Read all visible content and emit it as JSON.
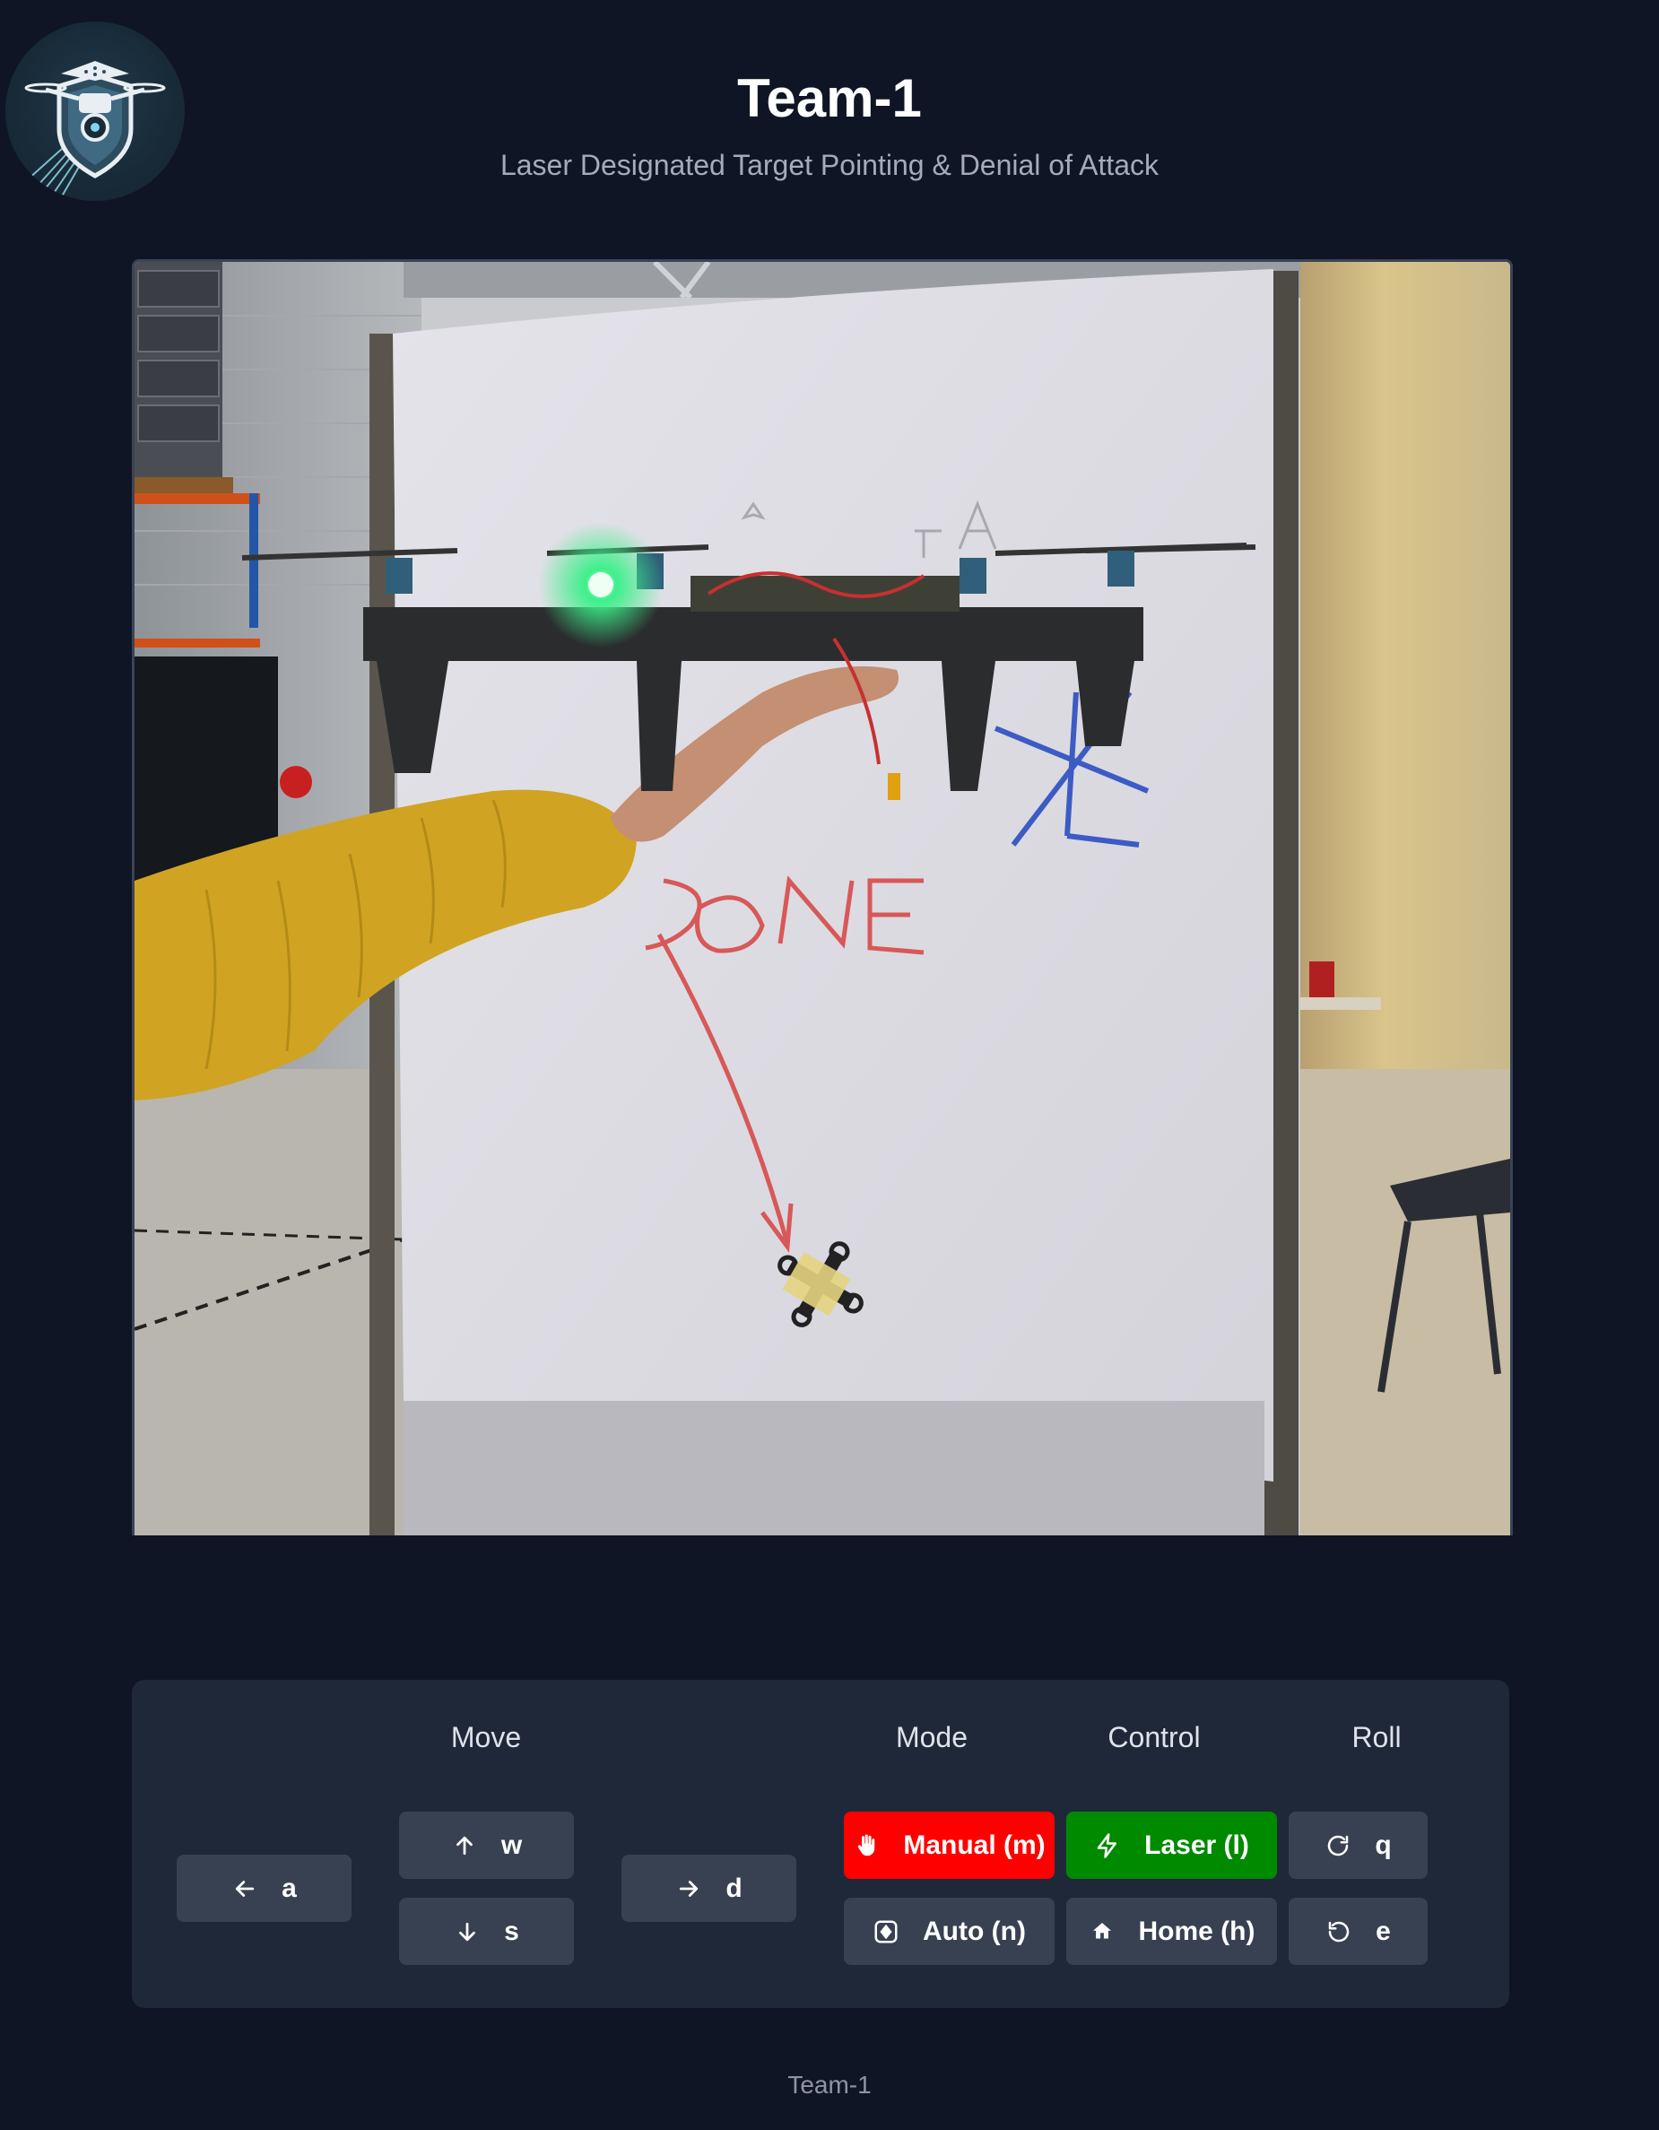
{
  "header": {
    "title": "Team-1",
    "subtitle": "Laser Designated Target Pointing & Denial of Attack",
    "logo_icon": "drone-shield-logo-icon"
  },
  "video": {
    "description_icon": "camera-feed"
  },
  "controls": {
    "groups": {
      "move": "Move",
      "mode": "Mode",
      "control": "Control",
      "roll": "Roll"
    },
    "buttons": {
      "left": {
        "key": "a",
        "icon": "arrow-left-icon"
      },
      "up": {
        "key": "w",
        "icon": "arrow-up-icon"
      },
      "down": {
        "key": "s",
        "icon": "arrow-down-icon"
      },
      "right": {
        "key": "d",
        "icon": "arrow-right-icon"
      },
      "manual": {
        "label": "Manual (m)",
        "icon": "hand-icon",
        "color": "#ff0000"
      },
      "auto": {
        "label": "Auto (n)",
        "icon": "auto-icon"
      },
      "laser": {
        "label": "Laser (l)",
        "icon": "lightning-icon",
        "color": "#008a00"
      },
      "home": {
        "label": "Home (h)",
        "icon": "home-icon"
      },
      "roll_right": {
        "key": "q",
        "icon": "rotate-clockwise-icon"
      },
      "roll_left": {
        "key": "e",
        "icon": "rotate-counterclockwise-icon"
      }
    }
  },
  "footer": {
    "text": "Team-1"
  },
  "colors": {
    "background": "#0f1524",
    "panel": "#1f2838",
    "button": "#374151"
  }
}
